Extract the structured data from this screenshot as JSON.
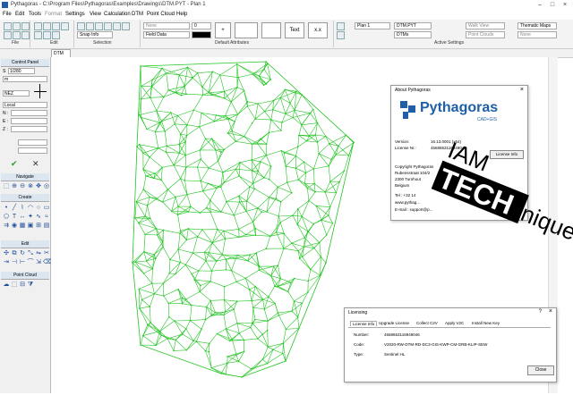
{
  "window": {
    "title": "Pythagoras - C:\\Program Files\\Pythagoras\\Examples\\Drawings\\DTM.PYT - Plan 1"
  },
  "menu": [
    "File",
    "Edit",
    "Tools",
    "Format",
    "Settings",
    "View",
    "Calculation",
    "DTM",
    "Point Cloud",
    "Help"
  ],
  "ribbon": {
    "snap_label": "Snap Info",
    "layer_none": "None",
    "field_data": "Field Data",
    "text_btn": "Text",
    "xz_btn": "x.x",
    "plan_combo": "Plan 1",
    "dtm_combo": "DTM.PYT",
    "dtms_combo": "DTMs",
    "walk_view": "Walk View",
    "point_clouds": "Point Clouds",
    "thematic_maps": "Thematic Maps",
    "none2": "None",
    "group_file": "File",
    "group_edit": "Edit",
    "group_selection": "Selection",
    "group_default_attr": "Default Attributes",
    "group_active_settings": "Active Settings"
  },
  "doc_tab": "DTM",
  "control_panel": {
    "title": "Control Panel",
    "scale": "1/280",
    "unit": "m",
    "nez": "NEZ",
    "local": "Local",
    "n_label": "N :",
    "e_label": "E :",
    "z_label": "Z :",
    "s_label": "S",
    "navigate": "Navigate",
    "create": "Create",
    "edit": "Edit",
    "point_cloud": "Point Cloud"
  },
  "about": {
    "title": "About Pythagoras",
    "brand": "Pythagoras",
    "brand_sub": "CAD+GIS",
    "version_label": "Version:",
    "version": "16.13.0001 (x64)",
    "license_label": "License Nr.:",
    "license": "4568653116949046",
    "license_info_btn": "License Info",
    "copyright": "Copyright Pythagoras",
    "street": "Rubensstraat 104/2",
    "city": "2300 Turnhout",
    "country": "Belgium",
    "tel": "Tel  : +32 14",
    "web": "www.pythag...",
    "email": "E-mail : support@p..."
  },
  "watermark": {
    "line1": "IAM",
    "line2": "TECH",
    "line3": "nique"
  },
  "licensing": {
    "title": "Licensing",
    "tabs": [
      "License Info",
      "Upgrade License",
      "Collect C2V",
      "Apply V2C",
      "Install New Key"
    ],
    "number_label": "Number:",
    "number": "4568653116949046",
    "code_label": "Code:",
    "code": "V2020-RW-DTM-RD-DC3-GIS-KWP-CM-GRB-KLIP-SEW",
    "type_label": "Type:",
    "type": "Sentinel HL",
    "close_btn": "Close"
  }
}
